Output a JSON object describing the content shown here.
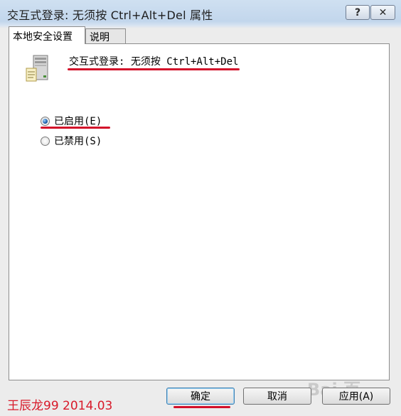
{
  "window": {
    "title": "交互式登录: 无须按 Ctrl+Alt+Del 属性",
    "help_label": "?",
    "close_label": "✕"
  },
  "tabs": [
    {
      "label": "本地安全设置",
      "active": true
    },
    {
      "label": "说明",
      "active": false
    }
  ],
  "policy": {
    "icon": "server-policy-icon",
    "title": "交互式登录: 无须按 Ctrl+Alt+Del"
  },
  "options": [
    {
      "label": "已启用(E)",
      "selected": true
    },
    {
      "label": "已禁用(S)",
      "selected": false
    }
  ],
  "buttons": {
    "ok": "确定",
    "cancel": "取消",
    "apply": "应用(A)"
  },
  "watermark": "王辰龙99 2014.03",
  "site_watermark": "Bai 百",
  "colors": {
    "annotation_red": "#d3102a",
    "watermark_red": "#d81a2a"
  }
}
